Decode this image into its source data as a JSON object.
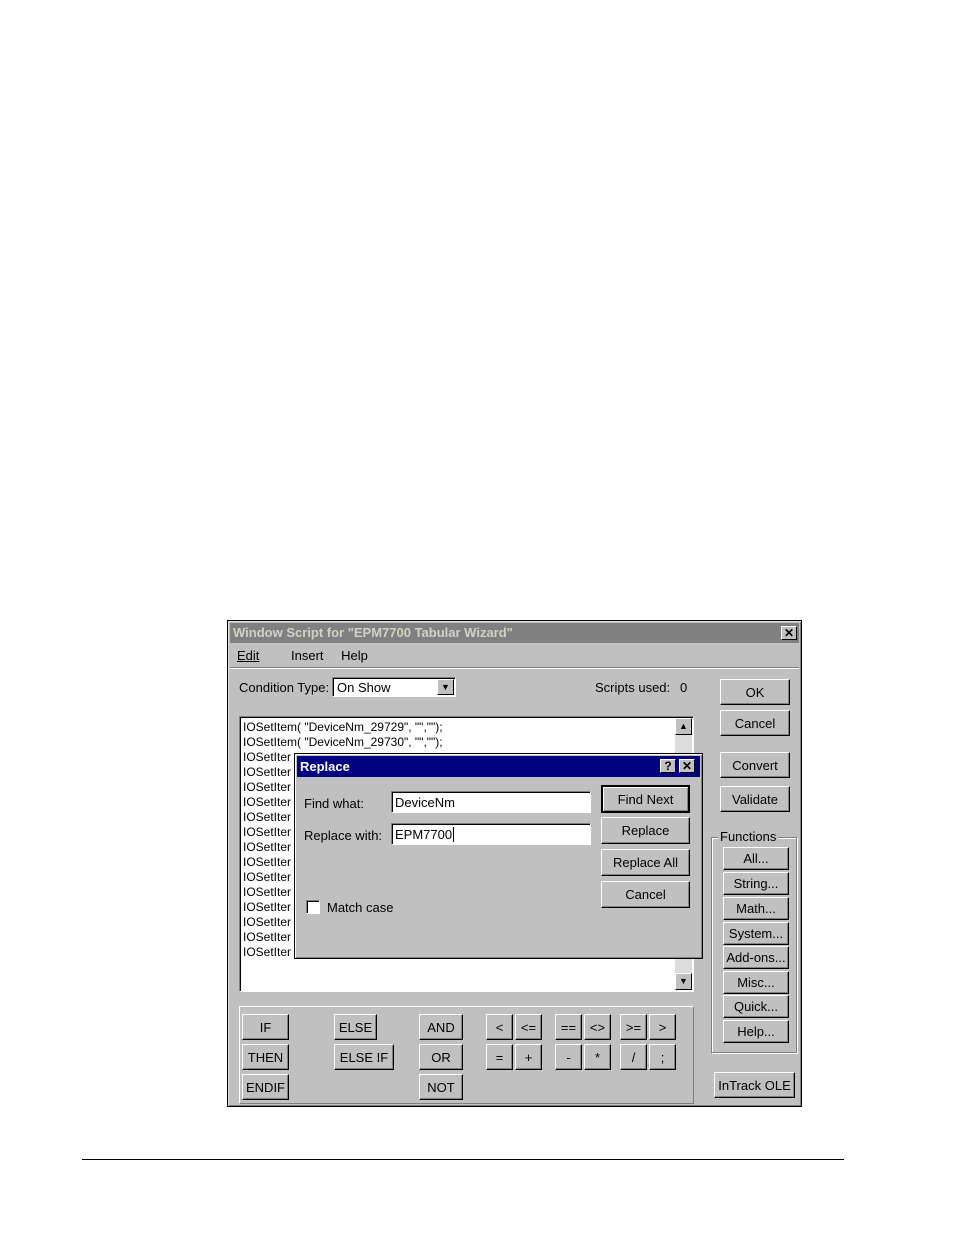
{
  "window": {
    "title": "Window Script for \"EPM7700 Tabular Wizard\"",
    "close": "✕"
  },
  "menu": {
    "edit": "Edit",
    "insert": "Insert",
    "help": "Help"
  },
  "condition": {
    "label": "Condition Type:",
    "value": "On Show"
  },
  "scripts_used": {
    "label": "Scripts used:",
    "value": "0"
  },
  "code_lines": [
    "IOSetItem( \"DeviceNm_29729\",  \"\",\"\");",
    "IOSetItem( \"DeviceNm_29730\",  \"\",\"\");",
    "IOSetIter",
    "IOSetIter",
    "IOSetIter",
    "IOSetIter",
    "IOSetIter",
    "IOSetIter",
    "IOSetIter",
    "IOSetIter",
    "IOSetIter",
    "IOSetIter",
    "IOSetIter",
    "IOSetIter",
    "IOSetIter",
    "IOSetIter"
  ],
  "right_buttons": {
    "ok": "OK",
    "cancel": "Cancel",
    "convert": "Convert",
    "validate": "Validate"
  },
  "functions": {
    "label": "Functions",
    "buttons": [
      "All...",
      "String...",
      "Math...",
      "System...",
      "Add-ons...",
      "Misc...",
      "Quick...",
      "Help..."
    ]
  },
  "intrack": "InTrack OLE",
  "keywords": {
    "if": "IF",
    "then": "THEN",
    "endif": "ENDIF",
    "else": "ELSE",
    "elseif": "ELSE IF",
    "and": "AND",
    "or": "OR",
    "not": "NOT"
  },
  "operators": {
    "row1": [
      "<",
      "<=",
      "==",
      "<>",
      ">=",
      ">"
    ],
    "row2": [
      "=",
      "+",
      "-",
      "*",
      "/",
      ";"
    ]
  },
  "replace_dialog": {
    "title": "Replace",
    "help": "?",
    "close": "✕",
    "find_label": "Find what:",
    "find_value": "DeviceNm",
    "replace_label": "Replace with:",
    "replace_value": "EPM7700",
    "match_case": "Match case",
    "find_next": "Find Next",
    "replace": "Replace",
    "replace_all": "Replace All",
    "cancel": "Cancel"
  }
}
